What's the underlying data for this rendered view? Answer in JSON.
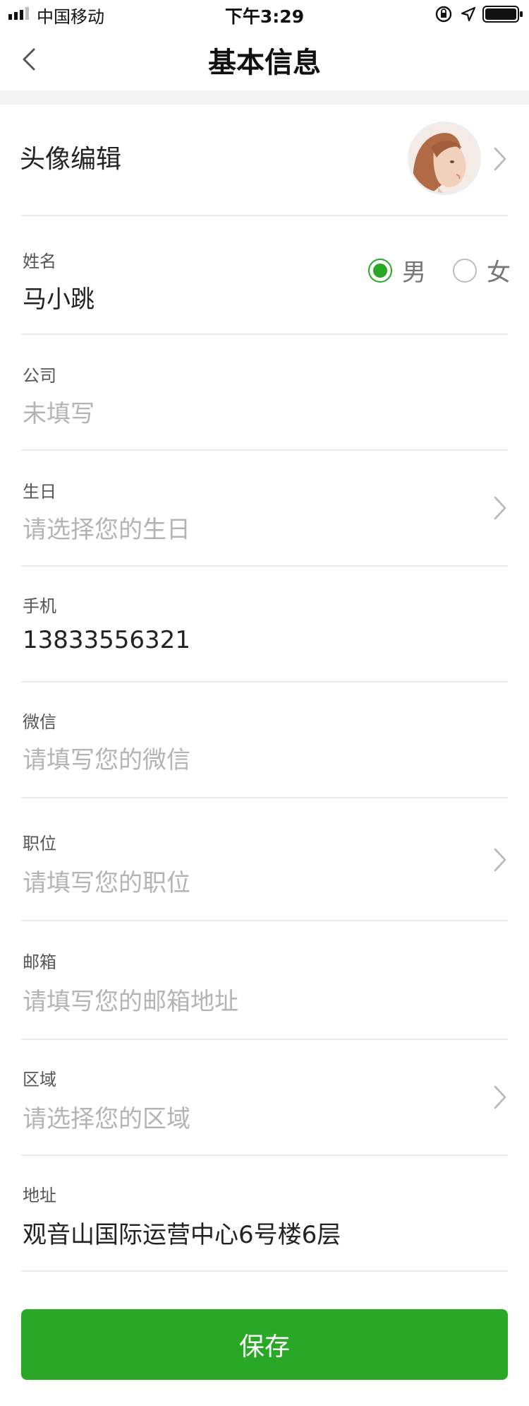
{
  "status_bar": {
    "carrier": "中国移动",
    "time": "下午3:29"
  },
  "nav": {
    "title": "基本信息"
  },
  "avatar_row": {
    "title": "头像编辑"
  },
  "name_field": {
    "label": "姓名",
    "value": "马小跳",
    "gender_options": [
      {
        "label": "男",
        "selected": true
      },
      {
        "label": "女",
        "selected": false
      }
    ]
  },
  "company_field": {
    "label": "公司",
    "placeholder": "未填写"
  },
  "birthday_field": {
    "label": "生日",
    "placeholder": "请选择您的生日"
  },
  "phone_field": {
    "label": "手机",
    "value": "13833556321"
  },
  "wechat_field": {
    "label": "微信",
    "placeholder": "请填写您的微信"
  },
  "position_field": {
    "label": "职位",
    "placeholder": "请填写您的职位"
  },
  "email_field": {
    "label": "邮箱",
    "placeholder": "请填写您的邮箱地址"
  },
  "region_field": {
    "label": "区域",
    "placeholder": "请选择您的区域"
  },
  "address_field": {
    "label": "地址",
    "value": "观音山国际运营中心6号楼6层"
  },
  "save_label": "保存",
  "colors": {
    "accent_green": "#28a825",
    "placeholder_gray": "#b4b4b4",
    "divider": "#ececec"
  }
}
